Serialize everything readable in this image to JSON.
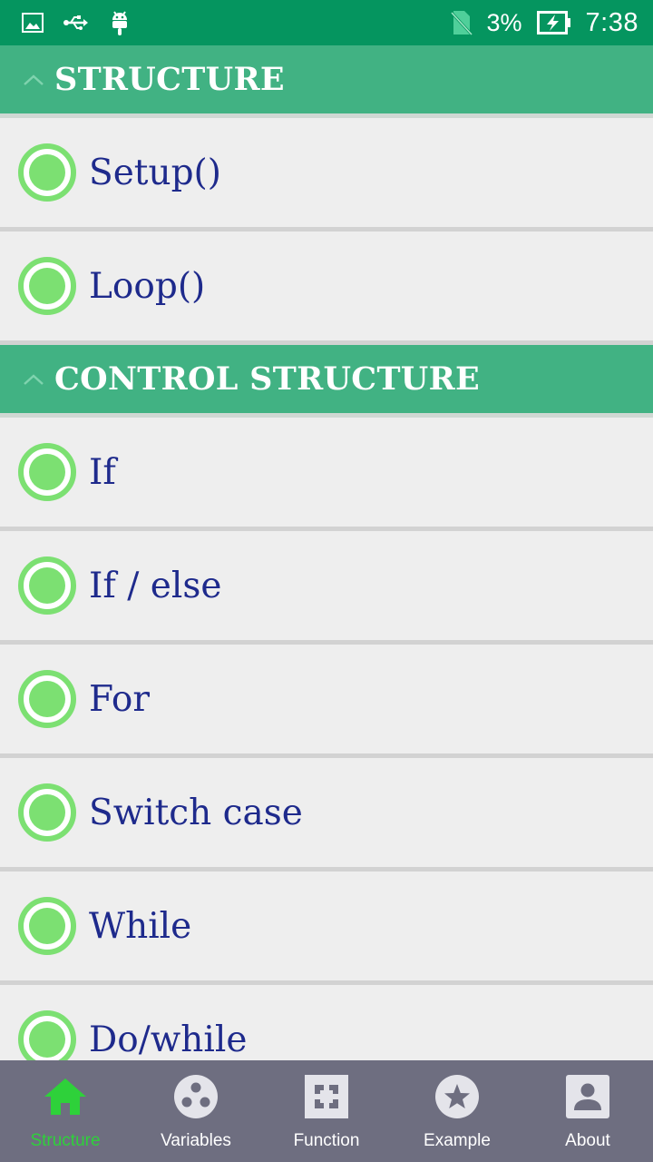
{
  "status_bar": {
    "battery_percent": "3%",
    "time": "7:38",
    "icons_left": [
      "image-icon",
      "usb-icon",
      "android-icon"
    ],
    "icons_right": [
      "no-sim-icon",
      "battery-charging-icon"
    ]
  },
  "sections": [
    {
      "title": "STRUCTURE",
      "items": [
        {
          "label": "Setup()"
        },
        {
          "label": "Loop()"
        }
      ]
    },
    {
      "title": "CONTROL STRUCTURE",
      "items": [
        {
          "label": "If"
        },
        {
          "label": "If / else"
        },
        {
          "label": "For"
        },
        {
          "label": "Switch case"
        },
        {
          "label": "While"
        },
        {
          "label": "Do/while"
        }
      ]
    }
  ],
  "bottom_nav": {
    "items": [
      {
        "label": "Structure",
        "icon": "home-icon",
        "active": true
      },
      {
        "label": "Variables",
        "icon": "variables-icon",
        "active": false
      },
      {
        "label": "Function",
        "icon": "function-icon",
        "active": false
      },
      {
        "label": "Example",
        "icon": "star-icon",
        "active": false
      },
      {
        "label": "About",
        "icon": "about-icon",
        "active": false
      }
    ]
  },
  "colors": {
    "status_bar": "#05955f",
    "section_header": "#41b283",
    "radio": "#7ce072",
    "item_text": "#1e2a8c",
    "bottom_nav": "#6e6e80",
    "nav_active": "#2ed13a"
  }
}
